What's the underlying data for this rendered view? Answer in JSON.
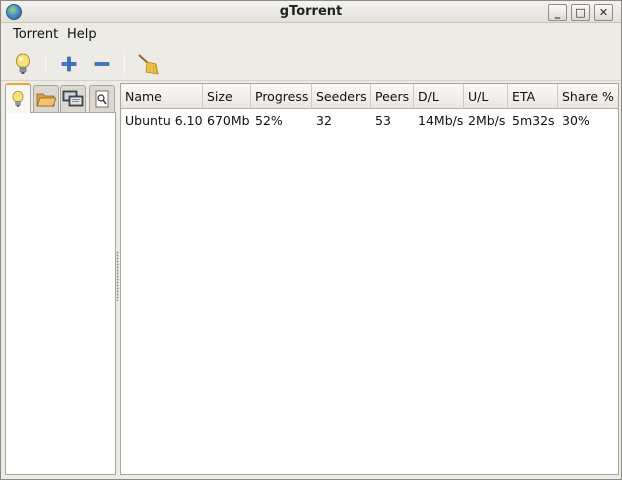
{
  "window": {
    "title": "gTorrent",
    "controls": {
      "minimize": "_",
      "maximize": "□",
      "close": "✕"
    }
  },
  "menu": {
    "items": [
      "Torrent",
      "Help"
    ]
  },
  "toolbar": {
    "icons": [
      "lightbulb-icon",
      "add-icon",
      "remove-icon",
      "broom-icon"
    ]
  },
  "sidebar": {
    "tabs": [
      "lightbulb-icon",
      "folder-icon",
      "network-icon",
      "document-search-icon"
    ]
  },
  "table": {
    "columns": [
      "Name",
      "Size",
      "Progress",
      "Seeders",
      "Peers",
      "D/L",
      "U/L",
      "ETA",
      "Share %"
    ],
    "rows": [
      [
        "Ubuntu 6.10",
        "670Mb",
        "52%",
        "32",
        "53",
        "14Mb/s",
        "2Mb/s",
        "5m32s",
        "30%"
      ]
    ]
  },
  "colors": {
    "accent": "#e8a73a",
    "add": "#2f6fd0",
    "remove": "#2f6fd0"
  }
}
